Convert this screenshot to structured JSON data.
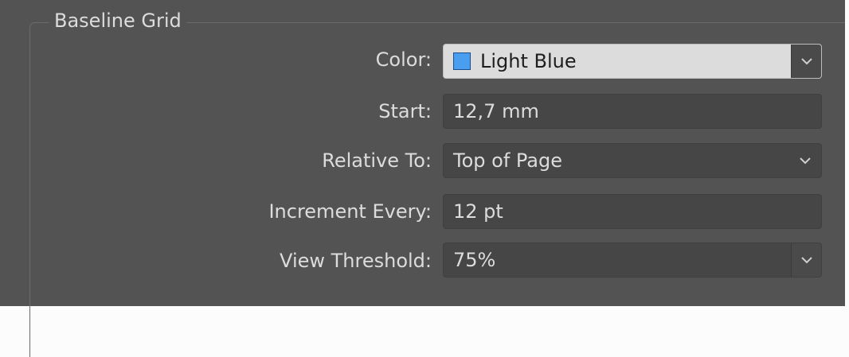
{
  "group": {
    "title": "Baseline Grid"
  },
  "fields": {
    "color": {
      "label": "Color:",
      "value": "Light Blue",
      "swatch_color": "#4a9ef0",
      "icon": "chevron-down-icon"
    },
    "start": {
      "label": "Start:",
      "value": "12,7 mm"
    },
    "relative_to": {
      "label": "Relative To:",
      "value": "Top of Page",
      "icon": "chevron-down-icon"
    },
    "increment_every": {
      "label": "Increment Every:",
      "value": "12 pt"
    },
    "view_threshold": {
      "label": "View Threshold:",
      "value": "75%",
      "icon": "chevron-down-icon"
    }
  }
}
